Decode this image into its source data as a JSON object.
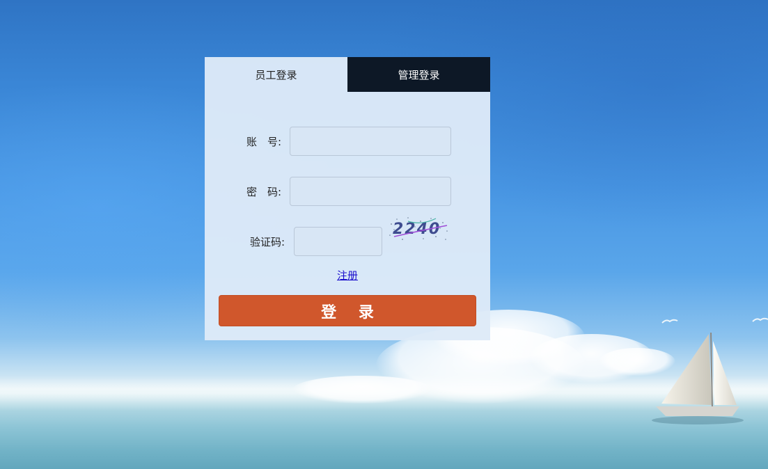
{
  "tabs": [
    {
      "label": "员工登录",
      "active": true
    },
    {
      "label": "管理登录",
      "active": false
    }
  ],
  "form": {
    "account_label": "账　号:",
    "account_value": "",
    "password_label": "密　码:",
    "password_value": "",
    "captcha_label": "验证码:",
    "captcha_value": "",
    "captcha_text": "2240"
  },
  "register_link": "注册",
  "login_button": "登 录",
  "colors": {
    "panel_bg": "#dee9f7",
    "inactive_tab_bg": "#0d1826",
    "login_button_bg": "#d0572c",
    "link_color": "#1a0dcc"
  },
  "icons": [
    "sailboat-icon",
    "bird-icon"
  ]
}
